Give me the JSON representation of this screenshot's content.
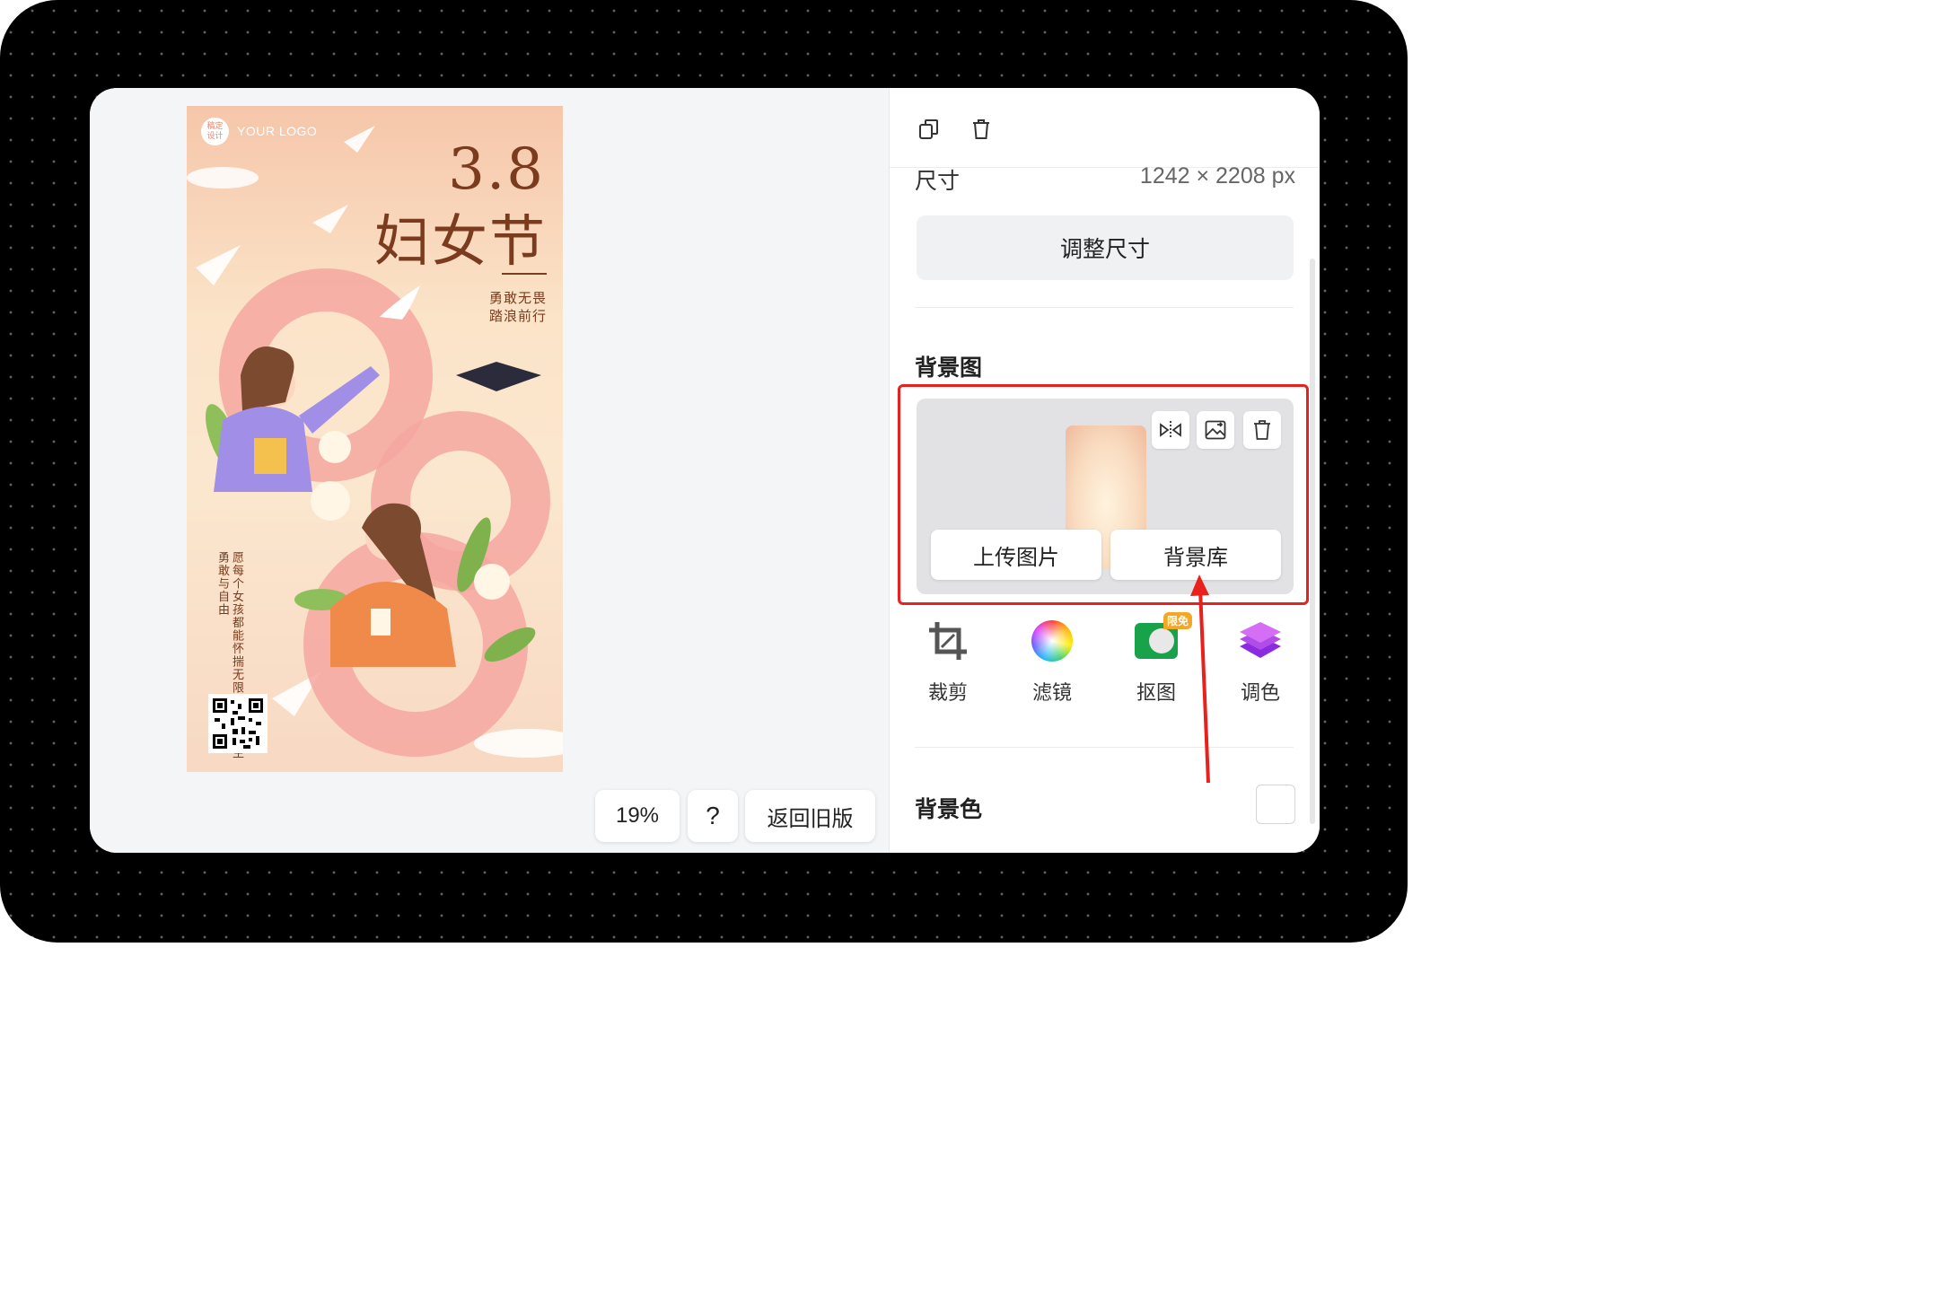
{
  "poster": {
    "logo_mark": "稿定\n设计",
    "logo_text": "YOUR LOGO",
    "number": "3.8",
    "festival": "妇女节",
    "slogan_line1": "勇敢无畏",
    "slogan_line2": "踏浪前行",
    "vertical_text": "愿每个女孩都能怀揣无限的梦想一生勇敢与自由"
  },
  "canvas_controls": {
    "zoom": "19%",
    "help": "?",
    "old_version": "返回旧版"
  },
  "panel": {
    "size_label": "尺寸",
    "size_value": "1242 × 2208 px",
    "resize_button": "调整尺寸",
    "background_image_title": "背景图",
    "upload_button": "上传图片",
    "library_button": "背景库",
    "tools": [
      {
        "label": "裁剪",
        "icon": "crop-icon"
      },
      {
        "label": "滤镜",
        "icon": "filter-icon"
      },
      {
        "label": "抠图",
        "icon": "cutout-icon",
        "badge": "限免"
      },
      {
        "label": "调色",
        "icon": "adjust-color-icon"
      }
    ],
    "background_color_title": "背景色"
  },
  "colors": {
    "highlight": "#e8211d",
    "poster_text": "#7a3b1e",
    "badge": "#f5a623"
  }
}
